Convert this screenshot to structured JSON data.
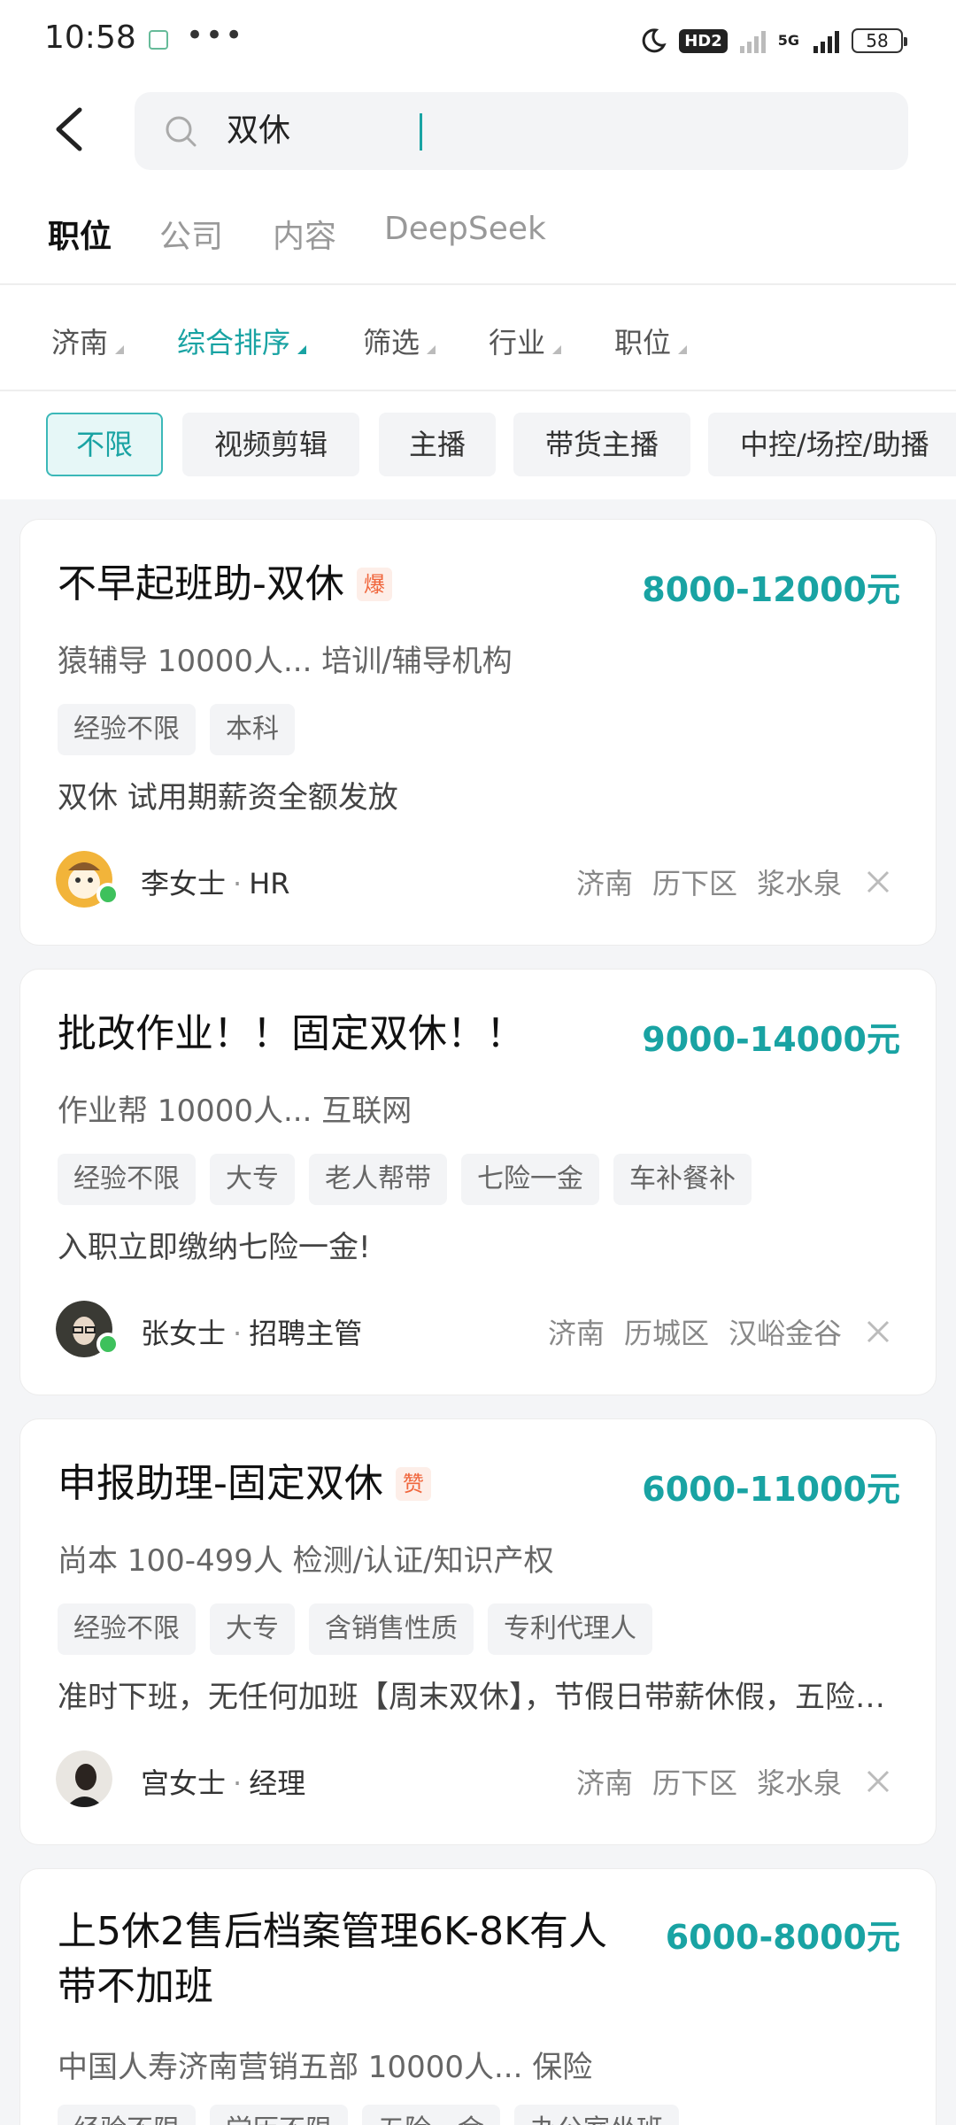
{
  "status_bar": {
    "time": "10:58",
    "battery": "58",
    "network": "5G",
    "hd": "HD2"
  },
  "search": {
    "query": "双休"
  },
  "tabs": [
    {
      "label": "职位",
      "active": true
    },
    {
      "label": "公司",
      "active": false
    },
    {
      "label": "内容",
      "active": false
    },
    {
      "label": "DeepSeek",
      "active": false
    }
  ],
  "filters": [
    {
      "label": "济南",
      "active": false
    },
    {
      "label": "综合排序",
      "active": true
    },
    {
      "label": "筛选",
      "active": false
    },
    {
      "label": "行业",
      "active": false
    },
    {
      "label": "职位",
      "active": false
    }
  ],
  "chips": [
    "不限",
    "视频剪辑",
    "主播",
    "带货主播",
    "中控/场控/助播"
  ],
  "jobs": [
    {
      "title": "不早起班助-双休",
      "badge": "爆",
      "salary": "8000-12000元",
      "company": "猿辅导  10000人...  培训/辅导机构",
      "tags": [
        "经验不限",
        "本科"
      ],
      "desc": "双休 试用期薪资全额发放",
      "recruiter": "李女士",
      "role": "HR",
      "location": [
        "济南",
        "历下区",
        "浆水泉"
      ]
    },
    {
      "title": "批改作业！！固定双休！！",
      "salary": "9000-14000元",
      "company": "作业帮  10000人...  互联网",
      "tags": [
        "经验不限",
        "大专",
        "老人帮带",
        "七险一金",
        "车补餐补"
      ],
      "desc": "入职立即缴纳七险一金!",
      "recruiter": "张女士",
      "role": "招聘主管",
      "location": [
        "济南",
        "历城区",
        "汉峪金谷"
      ]
    },
    {
      "title": "申报助理-固定双休",
      "badge": "赞",
      "salary": "6000-11000元",
      "company": "尚本  100-499人  检测/认证/知识产权",
      "tags": [
        "经验不限",
        "大专",
        "含销售性质",
        "专利代理人"
      ],
      "desc": "准时下班，无任何加班【周末双休】，节假日带薪休假，五险一金，带薪培训",
      "recruiter": "宫女士",
      "role": "经理",
      "location": [
        "济南",
        "历下区",
        "浆水泉"
      ]
    },
    {
      "title_line1": "上5休2售后档案管理6K-8K有人",
      "title_line2": "带不加班",
      "salary": "6000-8000元",
      "company": "中国人寿济南营销五部  10000人...  保险",
      "tags": [
        "经验不限",
        "学历不限",
        "五险一金",
        "办公室坐班"
      ]
    }
  ]
}
